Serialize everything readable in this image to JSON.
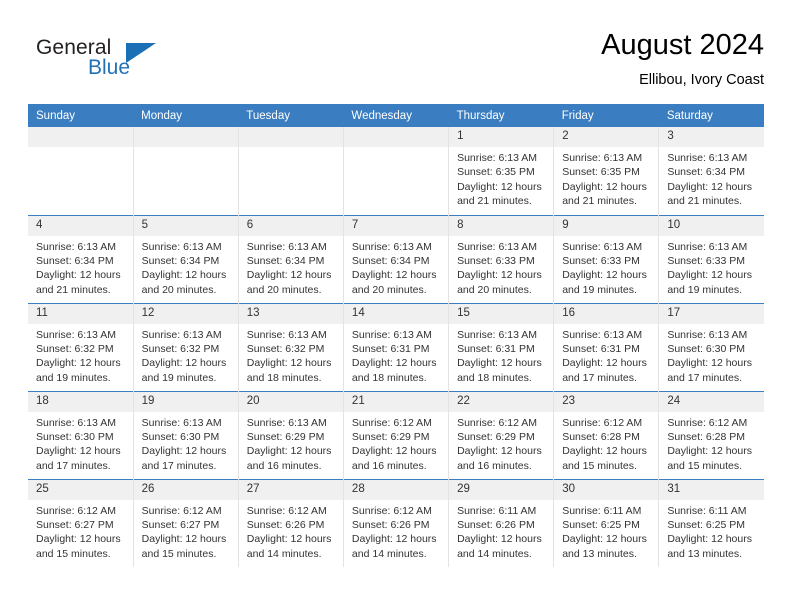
{
  "brand": {
    "name_top": "General",
    "name_bottom": "Blue",
    "accent_color": "#2272b6",
    "triangle_color": "#1a6fb5"
  },
  "header": {
    "title": "August 2024",
    "subtitle": "Ellibou, Ivory Coast"
  },
  "theme": {
    "header_bg": "#3a7dc0",
    "daynum_bg": "#f0f0f0",
    "text_color": "#333333"
  },
  "weekday_headers": [
    "Sunday",
    "Monday",
    "Tuesday",
    "Wednesday",
    "Thursday",
    "Friday",
    "Saturday"
  ],
  "labels": {
    "sunrise_prefix": "Sunrise:",
    "sunset_prefix": "Sunset:",
    "daylight_prefix": "Daylight:"
  },
  "weeks": [
    [
      {
        "day": "",
        "sunrise": "",
        "sunset": "",
        "daylight_1": "",
        "daylight_2": "",
        "empty": true
      },
      {
        "day": "",
        "sunrise": "",
        "sunset": "",
        "daylight_1": "",
        "daylight_2": "",
        "empty": true
      },
      {
        "day": "",
        "sunrise": "",
        "sunset": "",
        "daylight_1": "",
        "daylight_2": "",
        "empty": true
      },
      {
        "day": "",
        "sunrise": "",
        "sunset": "",
        "daylight_1": "",
        "daylight_2": "",
        "empty": true
      },
      {
        "day": "1",
        "sunrise": "Sunrise: 6:13 AM",
        "sunset": "Sunset: 6:35 PM",
        "daylight_1": "Daylight: 12 hours",
        "daylight_2": "and 21 minutes.",
        "empty": false
      },
      {
        "day": "2",
        "sunrise": "Sunrise: 6:13 AM",
        "sunset": "Sunset: 6:35 PM",
        "daylight_1": "Daylight: 12 hours",
        "daylight_2": "and 21 minutes.",
        "empty": false
      },
      {
        "day": "3",
        "sunrise": "Sunrise: 6:13 AM",
        "sunset": "Sunset: 6:34 PM",
        "daylight_1": "Daylight: 12 hours",
        "daylight_2": "and 21 minutes.",
        "empty": false
      }
    ],
    [
      {
        "day": "4",
        "sunrise": "Sunrise: 6:13 AM",
        "sunset": "Sunset: 6:34 PM",
        "daylight_1": "Daylight: 12 hours",
        "daylight_2": "and 21 minutes.",
        "empty": false
      },
      {
        "day": "5",
        "sunrise": "Sunrise: 6:13 AM",
        "sunset": "Sunset: 6:34 PM",
        "daylight_1": "Daylight: 12 hours",
        "daylight_2": "and 20 minutes.",
        "empty": false
      },
      {
        "day": "6",
        "sunrise": "Sunrise: 6:13 AM",
        "sunset": "Sunset: 6:34 PM",
        "daylight_1": "Daylight: 12 hours",
        "daylight_2": "and 20 minutes.",
        "empty": false
      },
      {
        "day": "7",
        "sunrise": "Sunrise: 6:13 AM",
        "sunset": "Sunset: 6:34 PM",
        "daylight_1": "Daylight: 12 hours",
        "daylight_2": "and 20 minutes.",
        "empty": false
      },
      {
        "day": "8",
        "sunrise": "Sunrise: 6:13 AM",
        "sunset": "Sunset: 6:33 PM",
        "daylight_1": "Daylight: 12 hours",
        "daylight_2": "and 20 minutes.",
        "empty": false
      },
      {
        "day": "9",
        "sunrise": "Sunrise: 6:13 AM",
        "sunset": "Sunset: 6:33 PM",
        "daylight_1": "Daylight: 12 hours",
        "daylight_2": "and 19 minutes.",
        "empty": false
      },
      {
        "day": "10",
        "sunrise": "Sunrise: 6:13 AM",
        "sunset": "Sunset: 6:33 PM",
        "daylight_1": "Daylight: 12 hours",
        "daylight_2": "and 19 minutes.",
        "empty": false
      }
    ],
    [
      {
        "day": "11",
        "sunrise": "Sunrise: 6:13 AM",
        "sunset": "Sunset: 6:32 PM",
        "daylight_1": "Daylight: 12 hours",
        "daylight_2": "and 19 minutes.",
        "empty": false
      },
      {
        "day": "12",
        "sunrise": "Sunrise: 6:13 AM",
        "sunset": "Sunset: 6:32 PM",
        "daylight_1": "Daylight: 12 hours",
        "daylight_2": "and 19 minutes.",
        "empty": false
      },
      {
        "day": "13",
        "sunrise": "Sunrise: 6:13 AM",
        "sunset": "Sunset: 6:32 PM",
        "daylight_1": "Daylight: 12 hours",
        "daylight_2": "and 18 minutes.",
        "empty": false
      },
      {
        "day": "14",
        "sunrise": "Sunrise: 6:13 AM",
        "sunset": "Sunset: 6:31 PM",
        "daylight_1": "Daylight: 12 hours",
        "daylight_2": "and 18 minutes.",
        "empty": false
      },
      {
        "day": "15",
        "sunrise": "Sunrise: 6:13 AM",
        "sunset": "Sunset: 6:31 PM",
        "daylight_1": "Daylight: 12 hours",
        "daylight_2": "and 18 minutes.",
        "empty": false
      },
      {
        "day": "16",
        "sunrise": "Sunrise: 6:13 AM",
        "sunset": "Sunset: 6:31 PM",
        "daylight_1": "Daylight: 12 hours",
        "daylight_2": "and 17 minutes.",
        "empty": false
      },
      {
        "day": "17",
        "sunrise": "Sunrise: 6:13 AM",
        "sunset": "Sunset: 6:30 PM",
        "daylight_1": "Daylight: 12 hours",
        "daylight_2": "and 17 minutes.",
        "empty": false
      }
    ],
    [
      {
        "day": "18",
        "sunrise": "Sunrise: 6:13 AM",
        "sunset": "Sunset: 6:30 PM",
        "daylight_1": "Daylight: 12 hours",
        "daylight_2": "and 17 minutes.",
        "empty": false
      },
      {
        "day": "19",
        "sunrise": "Sunrise: 6:13 AM",
        "sunset": "Sunset: 6:30 PM",
        "daylight_1": "Daylight: 12 hours",
        "daylight_2": "and 17 minutes.",
        "empty": false
      },
      {
        "day": "20",
        "sunrise": "Sunrise: 6:13 AM",
        "sunset": "Sunset: 6:29 PM",
        "daylight_1": "Daylight: 12 hours",
        "daylight_2": "and 16 minutes.",
        "empty": false
      },
      {
        "day": "21",
        "sunrise": "Sunrise: 6:12 AM",
        "sunset": "Sunset: 6:29 PM",
        "daylight_1": "Daylight: 12 hours",
        "daylight_2": "and 16 minutes.",
        "empty": false
      },
      {
        "day": "22",
        "sunrise": "Sunrise: 6:12 AM",
        "sunset": "Sunset: 6:29 PM",
        "daylight_1": "Daylight: 12 hours",
        "daylight_2": "and 16 minutes.",
        "empty": false
      },
      {
        "day": "23",
        "sunrise": "Sunrise: 6:12 AM",
        "sunset": "Sunset: 6:28 PM",
        "daylight_1": "Daylight: 12 hours",
        "daylight_2": "and 15 minutes.",
        "empty": false
      },
      {
        "day": "24",
        "sunrise": "Sunrise: 6:12 AM",
        "sunset": "Sunset: 6:28 PM",
        "daylight_1": "Daylight: 12 hours",
        "daylight_2": "and 15 minutes.",
        "empty": false
      }
    ],
    [
      {
        "day": "25",
        "sunrise": "Sunrise: 6:12 AM",
        "sunset": "Sunset: 6:27 PM",
        "daylight_1": "Daylight: 12 hours",
        "daylight_2": "and 15 minutes.",
        "empty": false
      },
      {
        "day": "26",
        "sunrise": "Sunrise: 6:12 AM",
        "sunset": "Sunset: 6:27 PM",
        "daylight_1": "Daylight: 12 hours",
        "daylight_2": "and 15 minutes.",
        "empty": false
      },
      {
        "day": "27",
        "sunrise": "Sunrise: 6:12 AM",
        "sunset": "Sunset: 6:26 PM",
        "daylight_1": "Daylight: 12 hours",
        "daylight_2": "and 14 minutes.",
        "empty": false
      },
      {
        "day": "28",
        "sunrise": "Sunrise: 6:12 AM",
        "sunset": "Sunset: 6:26 PM",
        "daylight_1": "Daylight: 12 hours",
        "daylight_2": "and 14 minutes.",
        "empty": false
      },
      {
        "day": "29",
        "sunrise": "Sunrise: 6:11 AM",
        "sunset": "Sunset: 6:26 PM",
        "daylight_1": "Daylight: 12 hours",
        "daylight_2": "and 14 minutes.",
        "empty": false
      },
      {
        "day": "30",
        "sunrise": "Sunrise: 6:11 AM",
        "sunset": "Sunset: 6:25 PM",
        "daylight_1": "Daylight: 12 hours",
        "daylight_2": "and 13 minutes.",
        "empty": false
      },
      {
        "day": "31",
        "sunrise": "Sunrise: 6:11 AM",
        "sunset": "Sunset: 6:25 PM",
        "daylight_1": "Daylight: 12 hours",
        "daylight_2": "and 13 minutes.",
        "empty": false
      }
    ]
  ]
}
